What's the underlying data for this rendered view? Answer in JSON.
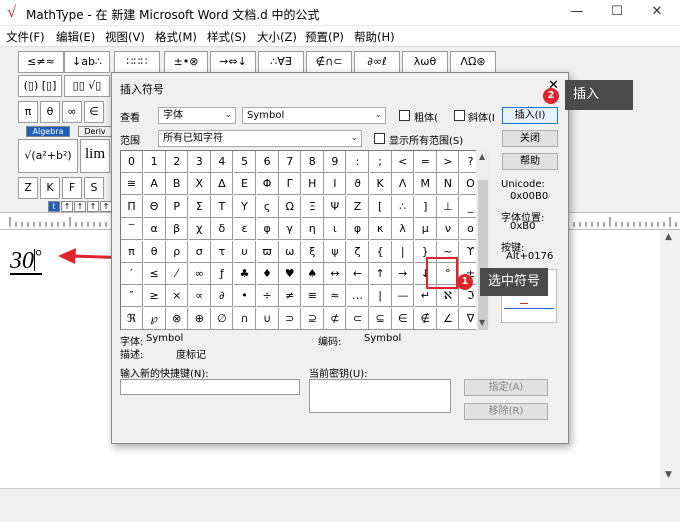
{
  "window": {
    "title": "MathType - 在 新建 Microsoft Word 文档.d 中的公式",
    "logo_text": "√",
    "minimize": "—",
    "maximize": "☐",
    "close": "✕"
  },
  "menu": [
    "文件(F)",
    "编辑(E)",
    "视图(V)",
    "格式(M)",
    "样式(S)",
    "大小(Z)",
    "预置(P)",
    "帮助(H)"
  ],
  "toolbar": {
    "row1": [
      "≤≠≈",
      "↓ab∴",
      "∷∷∷",
      "±•⊗",
      "→⇔↓",
      "∴∀∃",
      "∉∩⊂",
      "∂∞ℓ",
      "λωθ",
      "ΛΩ⊛"
    ],
    "row2": [
      "(▯) [▯]",
      "▯▯ √▯"
    ],
    "row3": [
      "π",
      "θ",
      "∞",
      "∈"
    ],
    "tabs": [
      "Algebra",
      "Deriv"
    ],
    "row4": [
      "√(a²+b²)",
      "lim"
    ],
    "row5": [
      "Z",
      "K",
      "F",
      "S"
    ],
    "small_tabs": [
      "t",
      "↑",
      "↑",
      "↑",
      "↑"
    ]
  },
  "editor": {
    "equation": "30",
    "degree": "°"
  },
  "dialog": {
    "title": "插入符号",
    "close": "✕",
    "view_label": "查看",
    "view_select": "字体",
    "font_select": "Symbol",
    "bold_label": "粗体(",
    "italic_label": "斜体(I",
    "insert_button": "插入(I)",
    "range_label": "范围",
    "range_select": "所有已知字符",
    "show_all_label": "显示所有范围(S)",
    "close_button": "关闭",
    "help_button": "帮助",
    "unicode_label": "Unicode:",
    "unicode_value": "0x00B0",
    "font_pos_label": "字体位置:",
    "font_pos_value": "0xB0",
    "keys_label": "按键:",
    "keys_value": "Alt+0176",
    "preview_symbol": "°",
    "font_info_label": "字体:",
    "font_info_value": "Symbol",
    "encoding_label": "编码:",
    "encoding_value": "Symbol",
    "desc_label": "描述:",
    "desc_value": "度标记",
    "shortcut_label": "输入新的快捷键(N):",
    "current_keys_label": "当前密钥(U):",
    "assign_button": "指定(A)",
    "remove_button": "移除(R)",
    "grid": [
      [
        "0",
        "1",
        "2",
        "3",
        "4",
        "5",
        "6",
        "7",
        "8",
        "9",
        ":",
        ";",
        "<",
        "=",
        ">",
        "?"
      ],
      [
        "≅",
        "Α",
        "Β",
        "Χ",
        "Δ",
        "Ε",
        "Φ",
        "Γ",
        "Η",
        "Ι",
        "ϑ",
        "Κ",
        "Λ",
        "Μ",
        "Ν",
        "Ο"
      ],
      [
        "Π",
        "Θ",
        "Ρ",
        "Σ",
        "Τ",
        "Υ",
        "ς",
        "Ω",
        "Ξ",
        "Ψ",
        "Ζ",
        "[",
        "∴",
        "]",
        "⊥",
        "_"
      ],
      [
        "‾",
        "α",
        "β",
        "χ",
        "δ",
        "ε",
        "φ",
        "γ",
        "η",
        "ι",
        "φ",
        "κ",
        "λ",
        "μ",
        "ν",
        "ο"
      ],
      [
        "π",
        "θ",
        "ρ",
        "σ",
        "τ",
        "υ",
        "ϖ",
        "ω",
        "ξ",
        "ψ",
        "ζ",
        "{",
        "|",
        "}",
        "~",
        "ϒ"
      ],
      [
        "′",
        "≤",
        "⁄",
        "∞",
        "ƒ",
        "♣",
        "♦",
        "♥",
        "♠",
        "↔",
        "←",
        "↑",
        "→",
        "↓",
        "°",
        "±"
      ],
      [
        "″",
        "≥",
        "×",
        "∝",
        "∂",
        "•",
        "÷",
        "≠",
        "≡",
        "≈",
        "…",
        "|",
        "—",
        "↵",
        "ℵ",
        "ℑ"
      ],
      [
        "ℜ",
        "℘",
        "⊗",
        "⊕",
        "∅",
        "∩",
        "∪",
        "⊃",
        "⊇",
        "⊄",
        "⊂",
        "⊆",
        "∈",
        "∉",
        "∠",
        "∇"
      ]
    ]
  },
  "callouts": {
    "one_num": "1",
    "one_text": "选中符号",
    "two_num": "2",
    "two_text": "插入"
  }
}
